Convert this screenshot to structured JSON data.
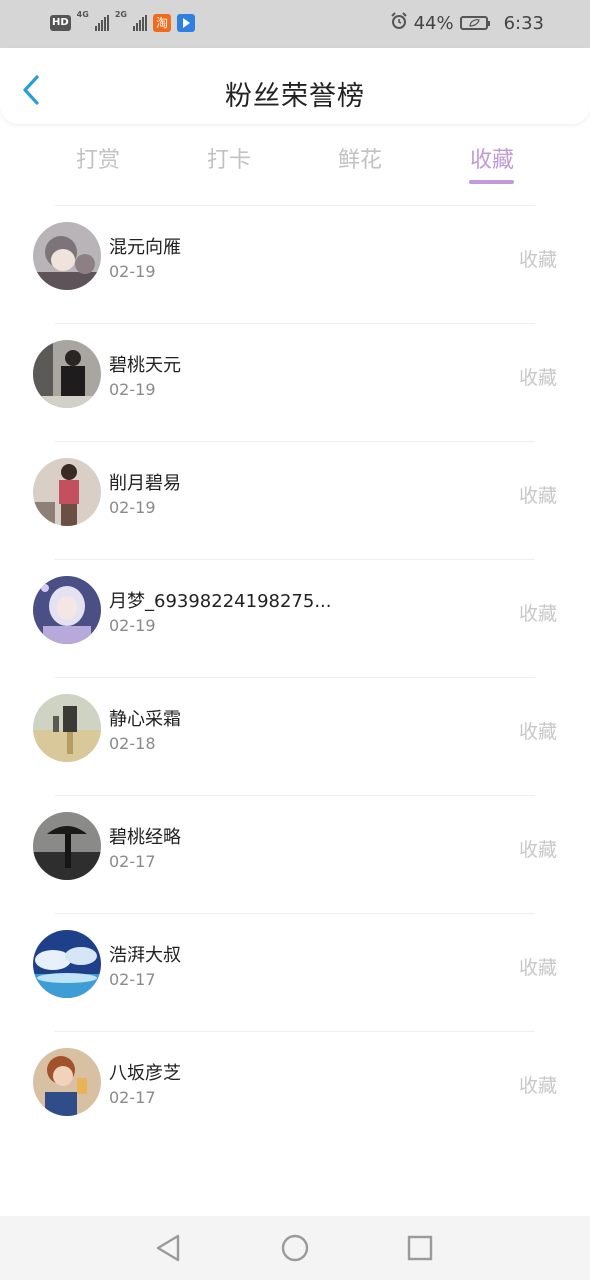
{
  "status_bar": {
    "hd": "HD",
    "net1": "4G",
    "net2": "2G",
    "taobao_glyph": "淘",
    "battery_percent": "44%",
    "time": "6:33",
    "icons": [
      "hd-icon",
      "signal-icon",
      "taobao-app-icon",
      "blue-app-icon",
      "alarm-icon",
      "battery-icon"
    ]
  },
  "header": {
    "title": "粉丝荣誉榜",
    "back_icon": "chevron-left-icon"
  },
  "tabs": [
    {
      "label": "打赏",
      "active": false
    },
    {
      "label": "打卡",
      "active": false
    },
    {
      "label": "鲜花",
      "active": false
    },
    {
      "label": "收藏",
      "active": true
    }
  ],
  "colors": {
    "accent": "#c29ad9",
    "back_arrow": "#2a9fd6",
    "inactive_text": "#c2c2c2"
  },
  "fans": [
    {
      "name": "混元向雁",
      "date": "02-19",
      "action": "收藏"
    },
    {
      "name": "碧桃天元",
      "date": "02-19",
      "action": "收藏"
    },
    {
      "name": "削月碧易",
      "date": "02-19",
      "action": "收藏"
    },
    {
      "name": "月梦_69398224198275...",
      "date": "02-19",
      "action": "收藏"
    },
    {
      "name": "静心采霜",
      "date": "02-18",
      "action": "收藏"
    },
    {
      "name": "碧桃经略",
      "date": "02-17",
      "action": "收藏"
    },
    {
      "name": "浩湃大叔",
      "date": "02-17",
      "action": "收藏"
    },
    {
      "name": "八坂彦芝",
      "date": "02-17",
      "action": "收藏"
    }
  ],
  "nav": {
    "icons": [
      "back-triangle-icon",
      "home-circle-icon",
      "recents-square-icon"
    ]
  }
}
